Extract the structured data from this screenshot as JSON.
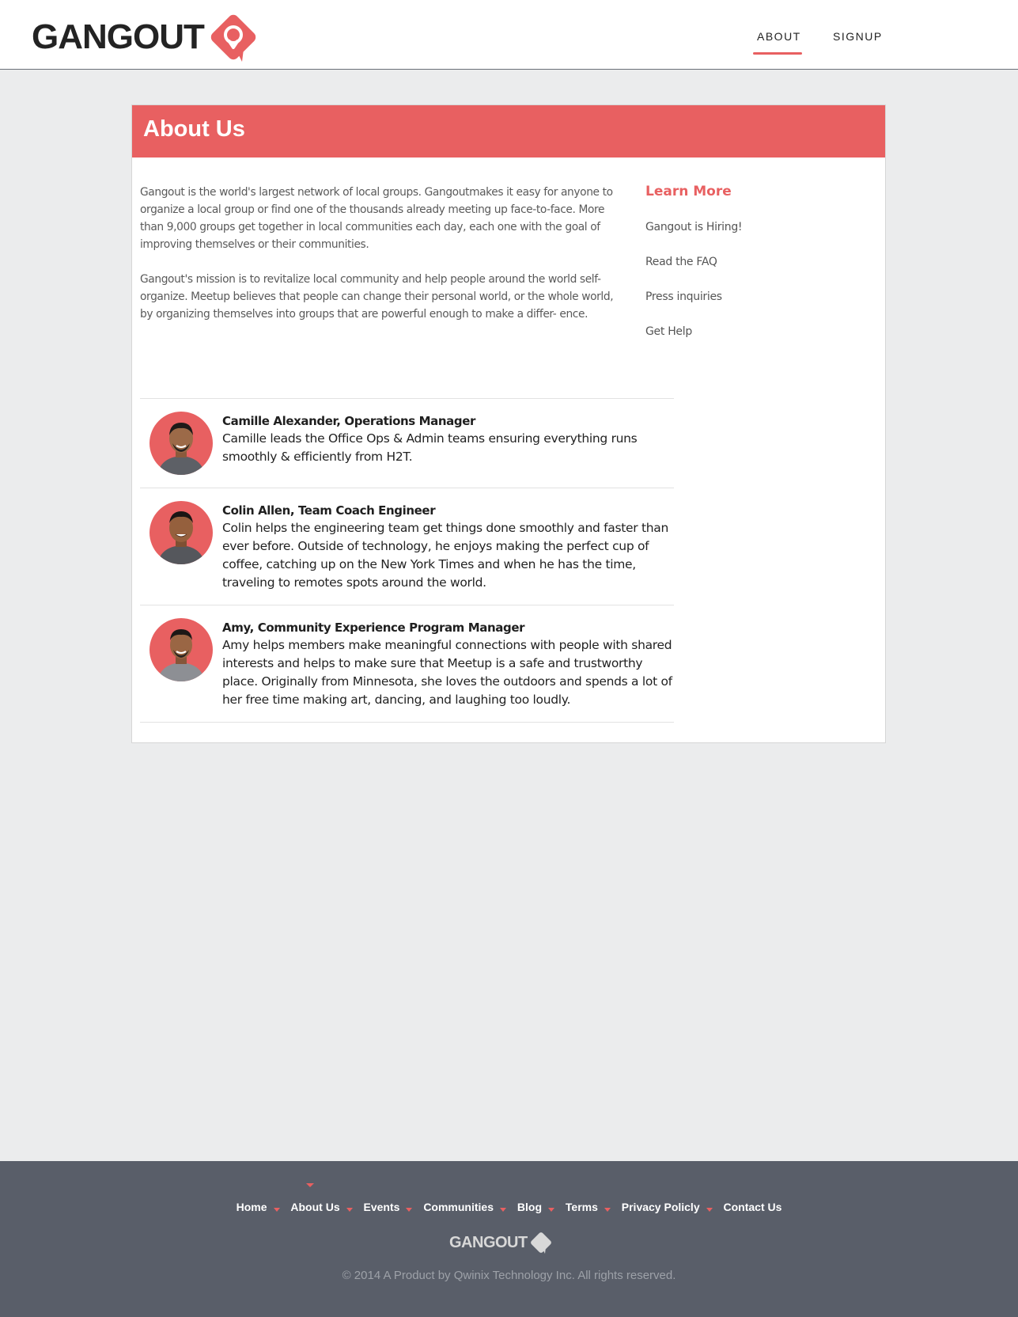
{
  "header": {
    "logo_text": "GANGOUT",
    "nav": {
      "about": "ABOUT",
      "signup": "SIGNUP"
    }
  },
  "card": {
    "title": "About Us",
    "intro": [
      "Gangout is the world's largest network of local groups. Gangoutmakes it easy for anyone to organize a local group or find one of the thousands already meeting up face-to-face. More than 9,000 groups get together in local communities each day, each one with the goal of improving themselves or their communities.",
      "Gangout's mission is to revitalize local community and help people around the world self-organize. Meetup believes that people can change their personal world, or the whole world, by organizing themselves into groups that are powerful enough to make a differ- ence."
    ],
    "learn_more": {
      "title": "Learn More",
      "links": [
        "Gangout is Hiring!",
        "Read the FAQ",
        "Press inquiries",
        "Get Help"
      ]
    },
    "team": [
      {
        "name": "Camille Alexander, Operations Manager",
        "description": "Camille leads the Office Ops & Admin teams ensuring everything runs smoothly & efficiently from H2T."
      },
      {
        "name": "Colin Allen, Team Coach Engineer",
        "description": "Colin helps the engineering team get things done smoothly and faster than ever before. Outside of technology, he enjoys making the perfect cup of coffee, catching up on the New York Times and when he has the time, traveling to remotes spots around the world."
      },
      {
        "name": "Amy, Community Experience Program Manager",
        "description": "Amy helps members make meaningful connections with people with shared interests and helps to make sure that Meetup is a safe and trustworthy place. Originally from Minnesota, she loves the outdoors and spends a lot of her free time making art, dancing, and laughing too loudly."
      }
    ]
  },
  "footer": {
    "links": [
      "Home",
      "About Us",
      "Events",
      "Communities",
      "Blog",
      "Terms",
      "Privacy Policly",
      "Contact Us"
    ],
    "logo_text": "GANGOUT",
    "copyright": "© 2014 A Product by Qwinix Technology Inc.  All rights reserved."
  },
  "colors": {
    "accent": "#e86061",
    "footer_bg": "#595e69",
    "page_bg": "#ebeced"
  },
  "icons": {
    "logo_mark": "location-pin-icon",
    "footer_caret": "caret-down-icon"
  }
}
